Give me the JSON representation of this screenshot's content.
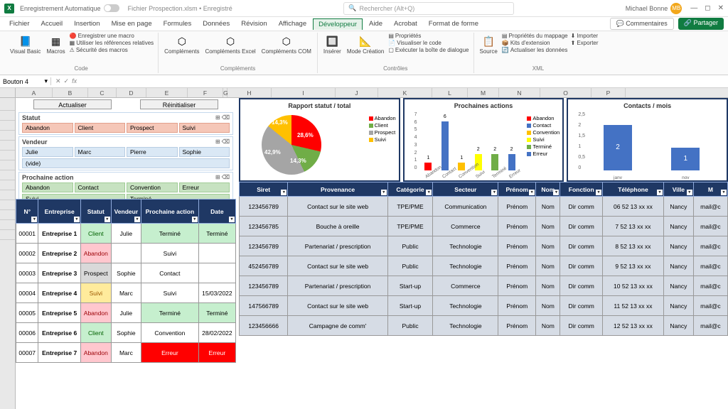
{
  "titlebar": {
    "autosave": "Enregistrement Automatique",
    "filename": "Fichier Prospection.xlsm • Enregistré",
    "search_placeholder": "Rechercher (Alt+Q)",
    "user": "Michael Bonne",
    "user_initials": "MB"
  },
  "tabs": [
    "Fichier",
    "Accueil",
    "Insertion",
    "Mise en page",
    "Formules",
    "Données",
    "Révision",
    "Affichage",
    "Développeur",
    "Aide",
    "Acrobat",
    "Format de forme"
  ],
  "active_tab": "Développeur",
  "tabs_right": {
    "comments": "Commentaires",
    "share": "Partager"
  },
  "ribbon": {
    "code": {
      "group": "Code",
      "vb": "Visual Basic",
      "macros": "Macros",
      "record": "Enregistrer une macro",
      "refs": "Utiliser les références relatives",
      "sec": "Sécurité des macros"
    },
    "addins": {
      "group": "Compléments",
      "comp": "Compléments",
      "excel": "Compléments Excel",
      "com": "Compléments COM"
    },
    "controls": {
      "group": "Contrôles",
      "insert": "Insérer",
      "design": "Mode Création",
      "props": "Propriétés",
      "view": "Visualiser le code",
      "dialog": "Exécuter la boîte de dialogue"
    },
    "xml": {
      "group": "XML",
      "source": "Source",
      "map": "Propriétés du mappage",
      "kits": "Kits d'extension",
      "refresh": "Actualiser les données",
      "import": "Importer",
      "export": "Exporter"
    }
  },
  "namebox": "Bouton 4",
  "columns": [
    "A",
    "B",
    "C",
    "D",
    "E",
    "F",
    "G",
    "H",
    "I",
    "J",
    "K",
    "L",
    "M",
    "N",
    "O",
    "P"
  ],
  "dash": {
    "btn1": "Actualiser",
    "btn2": "Réinitialiser",
    "slicers": [
      {
        "title": "Statut",
        "items": [
          "Abandon",
          "Client",
          "Prospect",
          "Suivi"
        ],
        "class": "salmon"
      },
      {
        "title": "Vendeur",
        "items": [
          "Julie",
          "Marc",
          "Pierre",
          "Sophie",
          "(vide)"
        ],
        "class": ""
      },
      {
        "title": "Prochaine action",
        "items": [
          "Abandon",
          "Contact",
          "Convention",
          "Erreur",
          "Suivi",
          "Terminé"
        ],
        "class": "green"
      }
    ]
  },
  "chart_data": [
    {
      "type": "pie",
      "title": "Rapport statut / total",
      "series": [
        {
          "name": "Abandon",
          "value": 28.6,
          "color": "#ff0000"
        },
        {
          "name": "Client",
          "value": 14.3,
          "color": "#70ad47"
        },
        {
          "name": "Prospect",
          "value": 42.9,
          "color": "#a5a5a5"
        },
        {
          "name": "Suivi",
          "value": 14.3,
          "color": "#ffc000"
        }
      ],
      "labels_shown": [
        "28,6%",
        "14,3%",
        "42,9%",
        "14,3%"
      ]
    },
    {
      "type": "bar",
      "title": "Prochaines actions",
      "categories": [
        "Abandon",
        "Contact",
        "Convention",
        "Suivi",
        "Terminé",
        "Erreur"
      ],
      "values": [
        1,
        6,
        1,
        2,
        2,
        2
      ],
      "colors": [
        "#ff0000",
        "#4472c4",
        "#ffc000",
        "#ffff00",
        "#70ad47",
        "#4472c4"
      ],
      "ylim": [
        0,
        7
      ]
    },
    {
      "type": "bar",
      "title": "Contacts / mois",
      "categories": [
        "janv",
        "nov"
      ],
      "values": [
        2,
        1
      ],
      "colors": [
        "#4472c4",
        "#4472c4"
      ],
      "ylim": [
        0,
        2.5
      ]
    }
  ],
  "left_headers": [
    "N°",
    "Entreprise",
    "Statut",
    "Vendeur",
    "Prochaine action",
    "Date"
  ],
  "right_headers": [
    "Siret",
    "Provenance",
    "Catégorie",
    "Secteur",
    "Prénom",
    "Nom",
    "Fonction",
    "Téléphone",
    "Ville",
    "M"
  ],
  "rows": [
    {
      "n": "00001",
      "ent": "Entreprise 1",
      "stat": "Client",
      "statc": "c-client",
      "vend": "Julie",
      "pa": "Terminé",
      "pac": "c-termine",
      "date": "Terminé",
      "datec": "c-termine",
      "siret": "123456789",
      "prov": "Contact sur le site web",
      "cat": "TPE/PME",
      "sect": "Communication",
      "pre": "Prénom",
      "nom": "Nom",
      "fon": "Dir comm",
      "tel": "06 52 13 xx xx",
      "vil": "Nancy",
      "m": "mail@c"
    },
    {
      "n": "00002",
      "ent": "Entreprise 2",
      "stat": "Abandon",
      "statc": "c-abandon",
      "vend": "",
      "pa": "Suivi",
      "pac": "",
      "date": "",
      "datec": "",
      "siret": "123456785",
      "prov": "Bouche à oreille",
      "cat": "TPE/PME",
      "sect": "Commerce",
      "pre": "Prénom",
      "nom": "Nom",
      "fon": "Dir comm",
      "tel": "7 52 13 xx xx",
      "vil": "Nancy",
      "m": "mail@c"
    },
    {
      "n": "00003",
      "ent": "Entreprise 3",
      "stat": "Prospect",
      "statc": "c-prospect",
      "vend": "Sophie",
      "pa": "Contact",
      "pac": "",
      "date": "",
      "datec": "",
      "siret": "123456789",
      "prov": "Partenariat / prescription",
      "cat": "Public",
      "sect": "Technologie",
      "pre": "Prénom",
      "nom": "Nom",
      "fon": "Dir comm",
      "tel": "8 52 13 xx xx",
      "vil": "Nancy",
      "m": "mail@c"
    },
    {
      "n": "00004",
      "ent": "Entreprise 4",
      "stat": "Suivi",
      "statc": "c-suivi",
      "vend": "Marc",
      "pa": "Suivi",
      "pac": "",
      "date": "15/03/2022",
      "datec": "",
      "siret": "452456789",
      "prov": "Contact sur le site web",
      "cat": "Public",
      "sect": "Technologie",
      "pre": "Prénom",
      "nom": "Nom",
      "fon": "Dir comm",
      "tel": "9 52 13 xx xx",
      "vil": "Nancy",
      "m": "mail@c"
    },
    {
      "n": "00005",
      "ent": "Entreprise 5",
      "stat": "Abandon",
      "statc": "c-abandon",
      "vend": "Julie",
      "pa": "Terminé",
      "pac": "c-termine",
      "date": "Terminé",
      "datec": "c-termine",
      "siret": "123456789",
      "prov": "Partenariat / prescription",
      "cat": "Start-up",
      "sect": "Commerce",
      "pre": "Prénom",
      "nom": "Nom",
      "fon": "Dir comm",
      "tel": "10 52 13 xx xx",
      "vil": "Nancy",
      "m": "mail@c"
    },
    {
      "n": "00006",
      "ent": "Entreprise 6",
      "stat": "Client",
      "statc": "c-client",
      "vend": "Sophie",
      "pa": "Convention",
      "pac": "",
      "date": "28/02/2022",
      "datec": "",
      "siret": "147566789",
      "prov": "Contact sur le site web",
      "cat": "Start-up",
      "sect": "Technologie",
      "pre": "Prénom",
      "nom": "Nom",
      "fon": "Dir comm",
      "tel": "11 52 13 xx xx",
      "vil": "Nancy",
      "m": "mail@c"
    },
    {
      "n": "00007",
      "ent": "Entreprise 7",
      "stat": "Abandon",
      "statc": "c-abandon",
      "vend": "Marc",
      "pa": "Erreur",
      "pac": "c-erreur",
      "date": "Erreur",
      "datec": "c-erreur",
      "siret": "123456666",
      "prov": "Campagne de comm'",
      "cat": "Public",
      "sect": "Technologie",
      "pre": "Prénom",
      "nom": "Nom",
      "fon": "Dir comm",
      "tel": "12 52 13 xx xx",
      "vil": "Nancy",
      "m": "mail@c"
    }
  ]
}
